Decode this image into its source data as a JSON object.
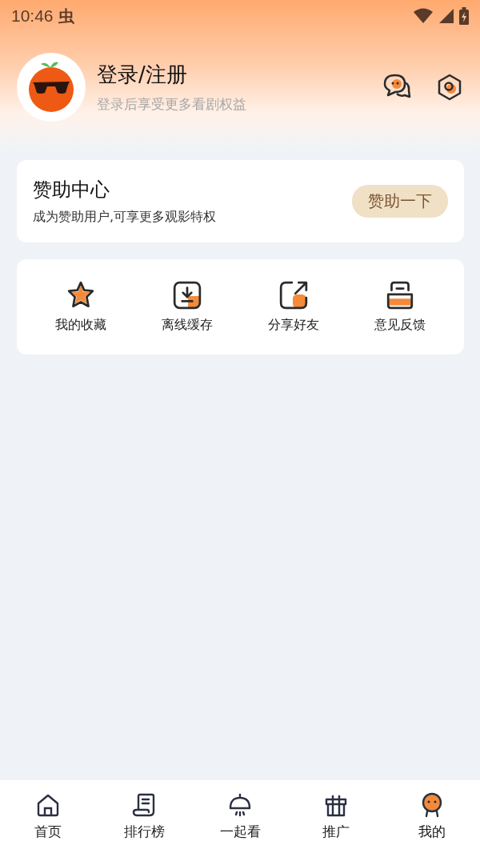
{
  "status_bar": {
    "time": "10:46",
    "notification_glyph": "虫"
  },
  "profile": {
    "title": "登录/注册",
    "subtitle": "登录后享受更多看剧权益"
  },
  "sponsor": {
    "title": "赞助中心",
    "description": "成为赞助用户,可享更多观影特权",
    "button": "赞助一下"
  },
  "shortcuts": [
    {
      "kind": "star",
      "label": "我的收藏"
    },
    {
      "kind": "download",
      "label": "离线缓存"
    },
    {
      "kind": "share",
      "label": "分享好友"
    },
    {
      "kind": "inbox",
      "label": "意见反馈"
    }
  ],
  "tabs": [
    {
      "kind": "home",
      "label": "首页",
      "selected": false
    },
    {
      "kind": "scroll",
      "label": "排行榜",
      "selected": false
    },
    {
      "kind": "bell",
      "label": "一起看",
      "selected": false
    },
    {
      "kind": "gift",
      "label": "推广",
      "selected": false
    },
    {
      "kind": "person",
      "label": "我的",
      "selected": true
    }
  ]
}
